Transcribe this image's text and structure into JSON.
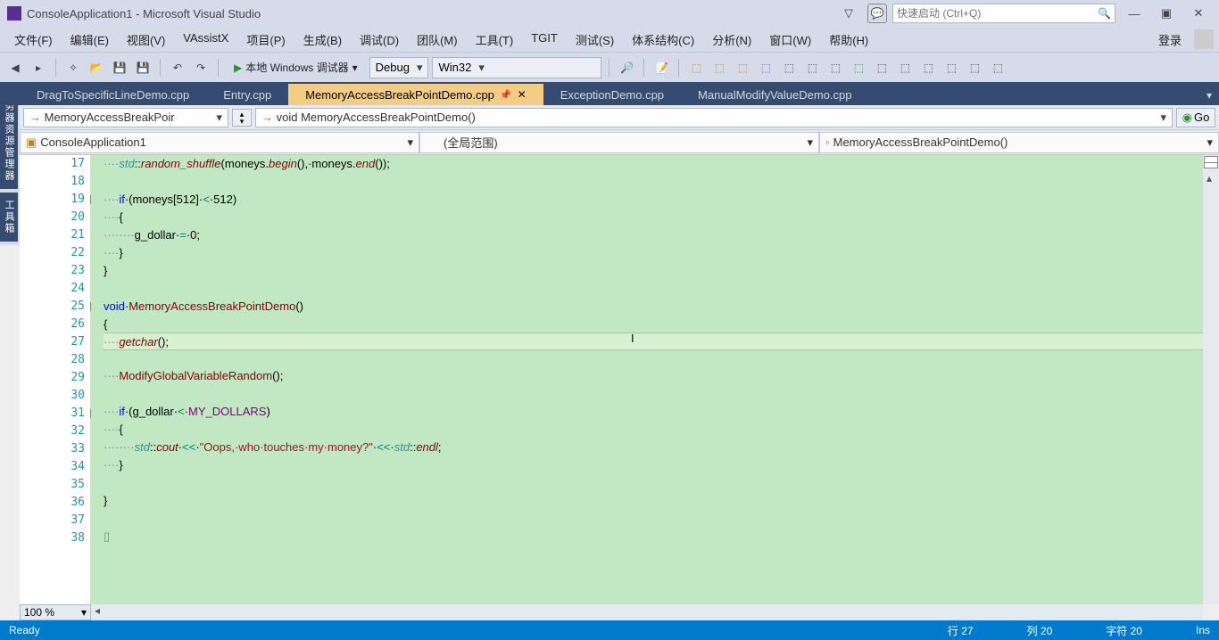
{
  "window": {
    "title": "ConsoleApplication1 - Microsoft Visual Studio",
    "search_placeholder": "快速启动 (Ctrl+Q)"
  },
  "menu": {
    "items": [
      "文件(F)",
      "编辑(E)",
      "视图(V)",
      "VAssistX",
      "项目(P)",
      "生成(B)",
      "调试(D)",
      "团队(M)",
      "工具(T)",
      "TGIT",
      "测试(S)",
      "体系结构(C)",
      "分析(N)",
      "窗口(W)",
      "帮助(H)"
    ],
    "login": "登录"
  },
  "toolbar": {
    "debug_label": "本地 Windows 调试器",
    "config": "Debug",
    "platform": "Win32"
  },
  "sidetabs": [
    "服务器资源管理器",
    "工具箱"
  ],
  "tabs": [
    {
      "label": "DragToSpecificLineDemo.cpp",
      "active": false
    },
    {
      "label": "Entry.cpp",
      "active": false
    },
    {
      "label": "MemoryAccessBreakPointDemo.cpp",
      "active": true
    },
    {
      "label": "ExceptionDemo.cpp",
      "active": false
    },
    {
      "label": "ManualModifyValueDemo.cpp",
      "active": false
    }
  ],
  "nav": {
    "scope_combo": "MemoryAccessBreakPoir",
    "member_combo": "void MemoryAccessBreakPointDemo()",
    "go_label": "Go",
    "project": "ConsoleApplication1",
    "global_scope": "(全局范围)",
    "function": "MemoryAccessBreakPointDemo()"
  },
  "editor": {
    "zoom": "100 %",
    "current_line": 27,
    "lines": [
      {
        "n": 17,
        "html": "<span class='dot'>····</span><span class='k-ital k-teal'>std</span>::<span class='k-ital k-red'>random_shuffle</span>(moneys.<span class='k-ital k-red'>begin</span>(),·moneys.<span class='k-ital k-red'>end</span>());"
      },
      {
        "n": 18,
        "html": ""
      },
      {
        "n": 19,
        "fold": true,
        "html": "<span class='dot'>····</span><span class='k-blue'>if</span>·(moneys[512]·<span class='k-op'>&lt;</span>·512)"
      },
      {
        "n": 20,
        "html": "<span class='dot'>····</span>{"
      },
      {
        "n": 21,
        "html": "<span class='dot'>········</span>g_dollar·<span class='k-op'>=</span>·0;"
      },
      {
        "n": 22,
        "html": "<span class='dot'>····</span>}"
      },
      {
        "n": 23,
        "html": "}"
      },
      {
        "n": 24,
        "html": ""
      },
      {
        "n": 25,
        "fold": true,
        "html": "<span class='k-blue'>void</span>·<span class='k-red'>MemoryAccessBreakPointDemo</span>()"
      },
      {
        "n": 26,
        "html": "{"
      },
      {
        "n": 27,
        "html": "<span class='dot'>····</span><span class='k-ital k-red'>getchar</span>();"
      },
      {
        "n": 28,
        "html": ""
      },
      {
        "n": 29,
        "html": "<span class='dot'>····</span><span class='k-red'>ModifyGlobalVariableRandom</span>();"
      },
      {
        "n": 30,
        "html": ""
      },
      {
        "n": 31,
        "fold": true,
        "html": "<span class='dot'>····</span><span class='k-blue'>if</span>·(g_dollar·<span class='k-op'>&lt;</span>·<span class='k-purple'>MY_DOLLARS</span>)"
      },
      {
        "n": 32,
        "html": "<span class='dot'>····</span>{"
      },
      {
        "n": 33,
        "html": "<span class='dot'>········</span><span class='k-ital k-teal'>std</span>::<span class='k-ital k-red'>cout</span>·<span class='k-op'>&lt;&lt;</span>·<span class='k-str'>\"Oops,·who·touches·my·money?\"</span>·<span class='k-op'>&lt;&lt;</span>·<span class='k-ital k-teal'>std</span>::<span class='k-ital k-red'>endl</span>;"
      },
      {
        "n": 34,
        "html": "<span class='dot'>····</span>}"
      },
      {
        "n": 35,
        "html": ""
      },
      {
        "n": 36,
        "html": "}"
      },
      {
        "n": 37,
        "html": ""
      },
      {
        "n": 38,
        "html": "<span class='k-gray'>▯</span>"
      }
    ]
  },
  "status": {
    "ready": "Ready",
    "line": "行 27",
    "col": "列 20",
    "char": "字符 20",
    "ins": "Ins"
  }
}
